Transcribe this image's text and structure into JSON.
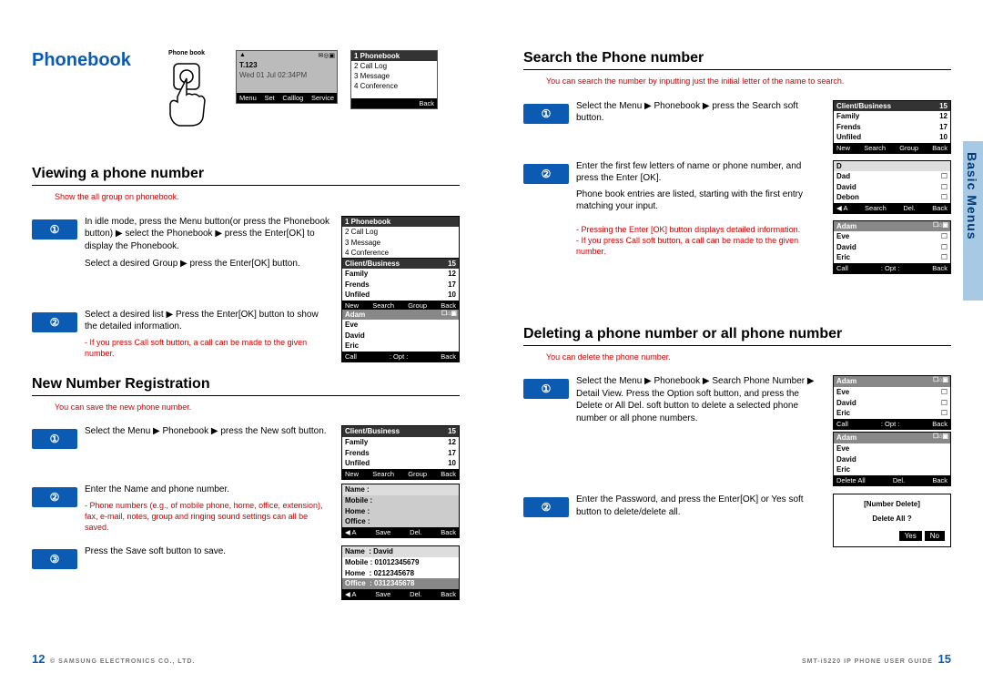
{
  "left": {
    "title": "Phonebook",
    "top_fig_label": "Phone book",
    "idle": {
      "title": "T.123",
      "date": "Wed 01 Jul 02:34PM",
      "soft": [
        "Menu",
        "Set",
        "Calllog",
        "Service"
      ]
    },
    "menu": {
      "items": [
        "1 Phonebook",
        "2 Call Log",
        "3 Message",
        "4 Conference"
      ],
      "back": "Back"
    },
    "view": {
      "heading": "Viewing a phone number",
      "sub": "Show the all group on phonebook.",
      "step1a": "In idle mode, press the Menu button(or press the Phonebook button) ▶ select the Phonebook ▶ press the Enter[OK] to display the Phonebook.",
      "step1b": "Select a desired Group ▶ press the Enter[OK] button.",
      "step2": "Select a desired list ▶ Press the Enter[OK] button to show the detailed information.",
      "note": "- If you press Call soft button, a call can be made to the given number.",
      "ss1": {
        "menu": [
          "1 Phonebook",
          "2 Call Log",
          "3 Message",
          "4 Conference"
        ],
        "rows": [
          [
            "Client/Business",
            "15"
          ],
          [
            "Family",
            "12"
          ],
          [
            "Frends",
            "17"
          ],
          [
            "Unfiled",
            "10"
          ]
        ],
        "soft": [
          "New",
          "Search",
          "Group",
          "Back"
        ]
      },
      "ss2": {
        "rows": [
          "Adam",
          "Eve",
          "David",
          "Eric"
        ],
        "soft": [
          "Call",
          ": Opt :",
          "Back"
        ]
      }
    },
    "reg": {
      "heading": "New Number Registration",
      "sub": "You can save the new phone number.",
      "step1": "Select the Menu ▶ Phonebook ▶ press the New soft button.",
      "step2": "Enter the Name and phone number.",
      "note2": "- Phone numbers (e.g., of mobile phone, home, office, extension), fax, e-mail, notes, group and ringing sound settings can all be saved.",
      "step3": "Press the Save soft button to save.",
      "ss1": {
        "rows": [
          [
            "Client/Business",
            "15"
          ],
          [
            "Family",
            "12"
          ],
          [
            "Frends",
            "17"
          ],
          [
            "Unfiled",
            "10"
          ]
        ],
        "soft": [
          "New",
          "Search",
          "Group",
          "Back"
        ]
      },
      "ss2": {
        "fields": [
          "Name  :",
          "Mobile :",
          "Home  :",
          "Office :"
        ],
        "soft": [
          "◀ A",
          "Save",
          "Del.",
          "Back"
        ]
      },
      "ss3": {
        "fields": [
          [
            "Name",
            "David"
          ],
          [
            "Mobile",
            "01012345679"
          ],
          [
            "Home",
            "0212345678"
          ],
          [
            "Office",
            "0312345678"
          ]
        ],
        "soft": [
          "◀ A",
          "Save",
          "Del.",
          "Back"
        ]
      }
    },
    "page": "12",
    "footer": "© SAMSUNG ELECTRONICS CO., LTD."
  },
  "right": {
    "tab": "Basic Menus",
    "search": {
      "heading": "Search the Phone number",
      "sub": "You can search the number by inputting just the initial letter of the name to search.",
      "step1": "Select the Menu ▶ Phonebook ▶ press the Search soft button.",
      "step2a": "Enter the first few letters of name or phone number, and press the Enter [OK].",
      "step2b": "Phone book entries are listed, starting with the first entry matching your input.",
      "note2a": "- Pressing the Enter [OK] button displays detailed information.",
      "note2b": "- If you press Call soft button, a call can be made to the given number.",
      "ss1": {
        "rows": [
          [
            "Client/Business",
            "15"
          ],
          [
            "Family",
            "12"
          ],
          [
            "Frends",
            "17"
          ],
          [
            "Unfiled",
            "10"
          ]
        ],
        "soft": [
          "New",
          "Search",
          "Group",
          "Back"
        ]
      },
      "ss2": {
        "input": "D",
        "rows": [
          "Dad",
          "David",
          "Debon"
        ],
        "soft": [
          "◀ A",
          "Search",
          "Del.",
          "Back"
        ]
      },
      "ss3": {
        "rows": [
          "Adam",
          "Eve",
          "David",
          "Eric"
        ],
        "soft": [
          "Call",
          ": Opt :",
          "Back"
        ]
      }
    },
    "del": {
      "heading": "Deleting a phone number or all phone number",
      "sub": "You can delete the phone number.",
      "step1": "Select the Menu ▶ Phonebook ▶ Search Phone Number ▶ Detail View. Press the Option soft button, and press the Delete or All Del. soft button to delete a selected phone number or all phone numbers.",
      "step2": "Enter the Password, and press the Enter[OK] or Yes soft button to delete/delete all.",
      "ss1": {
        "rows": [
          "Adam",
          "Eve",
          "David",
          "Eric"
        ],
        "soft": [
          "Call",
          ": Opt :",
          "Back"
        ]
      },
      "ss2": {
        "rows": [
          "Adam",
          "Eve",
          "David",
          "Eric"
        ],
        "soft": [
          "Delete All",
          "Del.",
          "Back"
        ]
      },
      "ss3": {
        "title": "[Number Delete]",
        "msg": "Delete All ?",
        "yes": "Yes",
        "no": "No"
      }
    },
    "page": "15",
    "footer": "SMT-i5220 IP PHONE USER GUIDE"
  }
}
